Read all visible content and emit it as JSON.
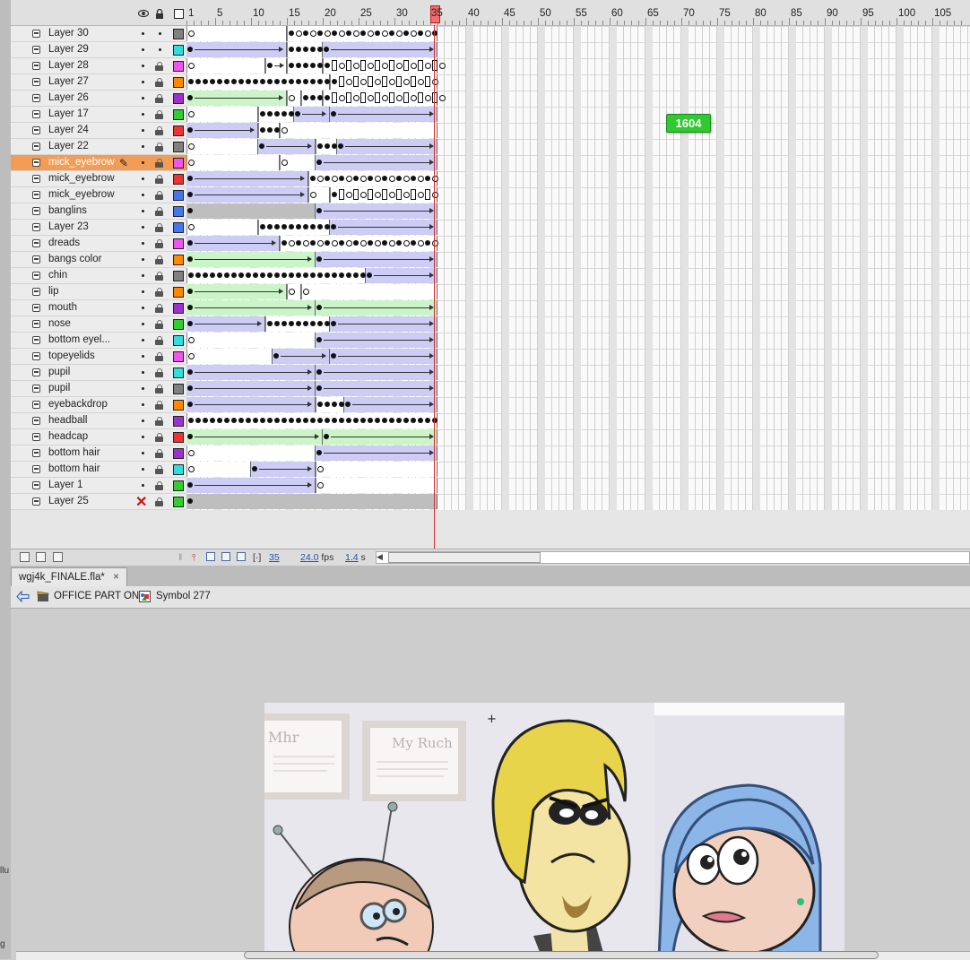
{
  "timeline": {
    "header_icons": {
      "eye": "eye-icon",
      "lock": "lock-icon",
      "outline": "outline-icon"
    },
    "ruler_labels": [
      "1",
      "5",
      "10",
      "15",
      "20",
      "25",
      "30",
      "40",
      "45",
      "50",
      "55",
      "60",
      "65",
      "70",
      "75",
      "80",
      "85",
      "90",
      "95",
      "100",
      "105"
    ],
    "current_frame": "35",
    "layers": [
      {
        "name": "Layer 30",
        "color": "#808080",
        "selected": false,
        "locked": false
      },
      {
        "name": "Layer 29",
        "color": "#33dddd",
        "selected": false,
        "locked": false
      },
      {
        "name": "Layer 28",
        "color": "#ee55ee",
        "selected": false,
        "locked": true
      },
      {
        "name": "Layer 27",
        "color": "#ff8800",
        "selected": false,
        "locked": true
      },
      {
        "name": "Layer 26",
        "color": "#9933cc",
        "selected": false,
        "locked": true
      },
      {
        "name": "Layer 17",
        "color": "#33cc33",
        "selected": false,
        "locked": true
      },
      {
        "name": "Layer 24",
        "color": "#ee3333",
        "selected": false,
        "locked": true
      },
      {
        "name": "Layer 22",
        "color": "#808080",
        "selected": false,
        "locked": true
      },
      {
        "name": "mick_eyebrow",
        "color": "#ee55ee",
        "selected": true,
        "locked": true
      },
      {
        "name": "mick_eyebrow",
        "color": "#ee3333",
        "selected": false,
        "locked": true
      },
      {
        "name": "mick_eyebrow",
        "color": "#4477ee",
        "selected": false,
        "locked": true
      },
      {
        "name": "banglins",
        "color": "#4477ee",
        "selected": false,
        "locked": true
      },
      {
        "name": "Layer 23",
        "color": "#4477ee",
        "selected": false,
        "locked": true
      },
      {
        "name": "dreads",
        "color": "#ee55ee",
        "selected": false,
        "locked": true
      },
      {
        "name": "bangs color",
        "color": "#ff8800",
        "selected": false,
        "locked": true
      },
      {
        "name": "chin",
        "color": "#808080",
        "selected": false,
        "locked": true
      },
      {
        "name": "lip",
        "color": "#ff8800",
        "selected": false,
        "locked": true
      },
      {
        "name": "mouth",
        "color": "#9933cc",
        "selected": false,
        "locked": true
      },
      {
        "name": "nose",
        "color": "#33cc33",
        "selected": false,
        "locked": true
      },
      {
        "name": "bottom eyel...",
        "color": "#33dddd",
        "selected": false,
        "locked": true
      },
      {
        "name": "topeyelids",
        "color": "#ee55ee",
        "selected": false,
        "locked": true
      },
      {
        "name": "pupil",
        "color": "#33dddd",
        "selected": false,
        "locked": true
      },
      {
        "name": "pupil",
        "color": "#808080",
        "selected": false,
        "locked": true
      },
      {
        "name": "eyebackdrop",
        "color": "#ff8800",
        "selected": false,
        "locked": true
      },
      {
        "name": "headball",
        "color": "#9933cc",
        "selected": false,
        "locked": true
      },
      {
        "name": "headcap",
        "color": "#ee3333",
        "selected": false,
        "locked": true
      },
      {
        "name": "bottom hair",
        "color": "#9933cc",
        "selected": false,
        "locked": true
      },
      {
        "name": "bottom hair",
        "color": "#33dddd",
        "selected": false,
        "locked": true
      },
      {
        "name": "Layer 1",
        "color": "#33cc33",
        "selected": false,
        "locked": true
      },
      {
        "name": "Layer 25",
        "color": "#33cc33",
        "selected": false,
        "locked": true,
        "hidden": true
      }
    ],
    "footer": {
      "frame": "35",
      "fps": "24.0",
      "fps_unit": "fps",
      "time": "1.4",
      "time_unit": "s"
    }
  },
  "badge": "1604",
  "document": {
    "tab_label": "wgj4k_FINALE.fla*",
    "tab_close": "×"
  },
  "breadcrumb": {
    "scene": "OFFICE PART ONE",
    "symbol": "Symbol 277"
  },
  "stage": {
    "whiteboard_left": "Mhr",
    "whiteboard_right": "My Ruch",
    "crosshair": "+"
  },
  "left_strip_chars": [
    "llu",
    "g"
  ]
}
